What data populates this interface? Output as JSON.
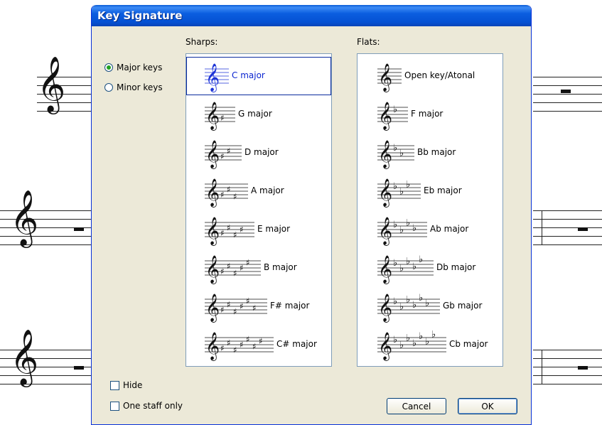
{
  "dialog": {
    "title": "Key Signature",
    "mode_options": [
      {
        "label": "Major keys",
        "selected": true
      },
      {
        "label": "Minor keys",
        "selected": false
      }
    ],
    "sharps_label": "Sharps:",
    "flats_label": "Flats:",
    "sharps": [
      {
        "label": "C major",
        "count": 0,
        "selected": true
      },
      {
        "label": "G major",
        "count": 1
      },
      {
        "label": "D major",
        "count": 2
      },
      {
        "label": "A major",
        "count": 3
      },
      {
        "label": "E major",
        "count": 4
      },
      {
        "label": "B major",
        "count": 5
      },
      {
        "label": "F# major",
        "count": 6
      },
      {
        "label": "C# major",
        "count": 7
      }
    ],
    "flats": [
      {
        "label": "Open key/Atonal",
        "count": 0
      },
      {
        "label": "F major",
        "count": 1
      },
      {
        "label": "Bb major",
        "count": 2
      },
      {
        "label": "Eb major",
        "count": 3
      },
      {
        "label": "Ab major",
        "count": 4
      },
      {
        "label": "Db major",
        "count": 5
      },
      {
        "label": "Gb major",
        "count": 6
      },
      {
        "label": "Cb major",
        "count": 7
      }
    ],
    "hide_label": "Hide",
    "hide_checked": false,
    "one_staff_label": "One staff only",
    "one_staff_checked": false,
    "cancel_label": "Cancel",
    "ok_label": "OK"
  },
  "colors": {
    "title_bar": "#0b5ee0",
    "selection": "#0a24d0",
    "dialog_bg": "#ece9d8"
  },
  "icons": {
    "clef": "treble-clef-icon",
    "sharp": "sharp-icon",
    "flat": "flat-icon",
    "rest": "whole-rest-icon"
  }
}
